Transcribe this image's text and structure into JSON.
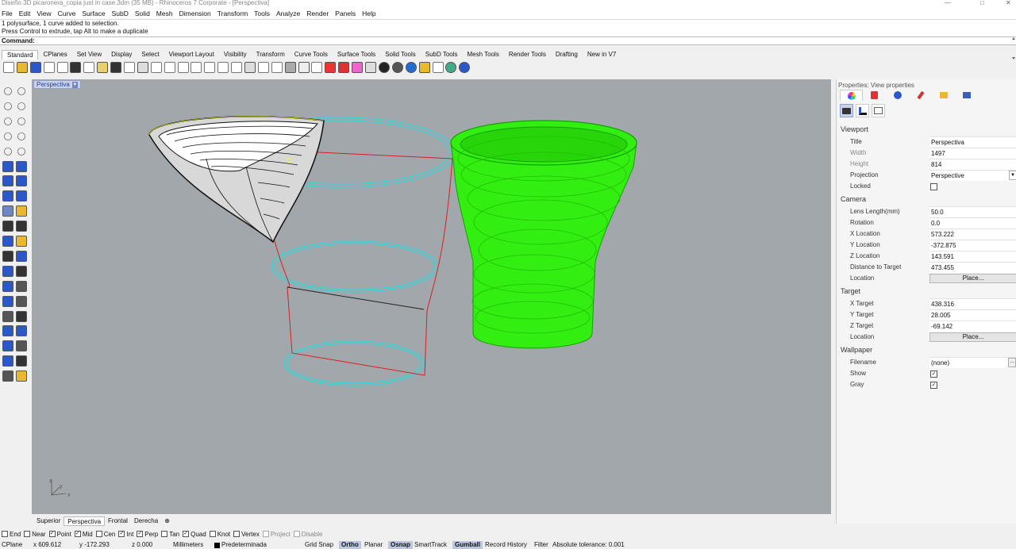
{
  "window": {
    "title": "Diseño 3D picaronera_copia just in case.3dm (35 MB) - Rhinoceros 7 Corporate - [Perspectiva]"
  },
  "menu": [
    "File",
    "Edit",
    "View",
    "Curve",
    "Surface",
    "SubD",
    "Solid",
    "Mesh",
    "Dimension",
    "Transform",
    "Tools",
    "Analyze",
    "Render",
    "Panels",
    "Help"
  ],
  "history": [
    "1 polysurface, 1 curve added to selection.",
    "Press Control to extrude, tap Alt to make a duplicate"
  ],
  "command": {
    "label": "Command:",
    "value": ""
  },
  "toolbar_tabs": [
    "Standard",
    "CPlanes",
    "Set View",
    "Display",
    "Select",
    "Viewport Layout",
    "Visibility",
    "Transform",
    "Curve Tools",
    "Surface Tools",
    "Solid Tools",
    "SubD Tools",
    "Mesh Tools",
    "Render Tools",
    "Drafting",
    "New in V7"
  ],
  "toolbar_active_tab": "Standard",
  "toolbar_icons": [
    "new-file",
    "open-file",
    "save-file",
    "print",
    "import",
    "cut",
    "copy",
    "paste",
    "undo",
    "pan",
    "rotate-view",
    "zoom",
    "zoom-window",
    "zoom-extents",
    "zoom-selected",
    "zoom-dynamic",
    "undo-view",
    "four-views",
    "grid",
    "named-views",
    "cplane",
    "lights",
    "points-on",
    "lock",
    "hide",
    "layers",
    "properties",
    "materials",
    "render",
    "render-preview",
    "environment",
    "curve-rebuild",
    "check",
    "sun",
    "help"
  ],
  "viewport": {
    "label": "Perspectiva",
    "axes": {
      "x": "x",
      "y": "y",
      "z": "z"
    }
  },
  "viewport_tabs": [
    "Superior",
    "Perspectiva",
    "Frontal",
    "Derecha"
  ],
  "viewport_active_tab": "Perspectiva",
  "osnap": [
    {
      "label": "End",
      "checked": false
    },
    {
      "label": "Near",
      "checked": false
    },
    {
      "label": "Point",
      "checked": true
    },
    {
      "label": "Mid",
      "checked": true
    },
    {
      "label": "Cen",
      "checked": false
    },
    {
      "label": "Int",
      "checked": true
    },
    {
      "label": "Perp",
      "checked": true
    },
    {
      "label": "Tan",
      "checked": false
    },
    {
      "label": "Quad",
      "checked": true
    },
    {
      "label": "Knot",
      "checked": false
    },
    {
      "label": "Vertex",
      "checked": false
    },
    {
      "label": "Project",
      "checked": false,
      "disabled": true
    },
    {
      "label": "Disable",
      "checked": false,
      "disabled": true
    }
  ],
  "status": {
    "cplane": "CPlane",
    "x": "x 609.612",
    "y": "y -172.293",
    "z": "z 0.000",
    "units": "Millimeters",
    "layer": "Predeterminada",
    "toggles": [
      "Grid Snap",
      "Ortho",
      "Planar",
      "Osnap",
      "SmartTrack",
      "Gumball",
      "Record History",
      "Filter"
    ],
    "active_toggles": [
      "Ortho",
      "Osnap",
      "Gumball"
    ],
    "tolerance": "Absolute tolerance: 0.001"
  },
  "properties": {
    "title": "Properties: View properties",
    "sections": {
      "viewport": "Viewport",
      "camera": "Camera",
      "target": "Target",
      "wallpaper": "Wallpaper"
    },
    "viewport": {
      "title": {
        "label": "Title",
        "value": "Perspectiva"
      },
      "width": {
        "label": "Width",
        "value": "1497"
      },
      "height": {
        "label": "Height",
        "value": "814"
      },
      "projection": {
        "label": "Projection",
        "value": "Perspective"
      },
      "locked": {
        "label": "Locked",
        "checked": false
      }
    },
    "camera": {
      "lens": {
        "label": "Lens Length(mm)",
        "value": "50.0"
      },
      "rotation": {
        "label": "Rotation",
        "value": "0.0"
      },
      "x": {
        "label": "X Location",
        "value": "573.222"
      },
      "y": {
        "label": "Y Location",
        "value": "-372.875"
      },
      "z": {
        "label": "Z Location",
        "value": "143.591"
      },
      "dist": {
        "label": "Distance to Target",
        "value": "473.455"
      },
      "location": {
        "label": "Location",
        "button": "Place..."
      }
    },
    "target": {
      "x": {
        "label": "X Target",
        "value": "438.316"
      },
      "y": {
        "label": "Y Target",
        "value": "28.005"
      },
      "z": {
        "label": "Z Target",
        "value": "-69.142"
      },
      "location": {
        "label": "Location",
        "button": "Place..."
      }
    },
    "wallpaper": {
      "filename": {
        "label": "Filename",
        "value": "(none)"
      },
      "show": {
        "label": "Show",
        "checked": true
      },
      "gray": {
        "label": "Gray",
        "checked": true
      }
    }
  },
  "colors": {
    "selection": "#ffff00",
    "solid_green": "#33ee11",
    "curve_cyan": "#39d3d6",
    "curve_red": "#d62020",
    "viewport_bg": "#a2a7ac"
  }
}
